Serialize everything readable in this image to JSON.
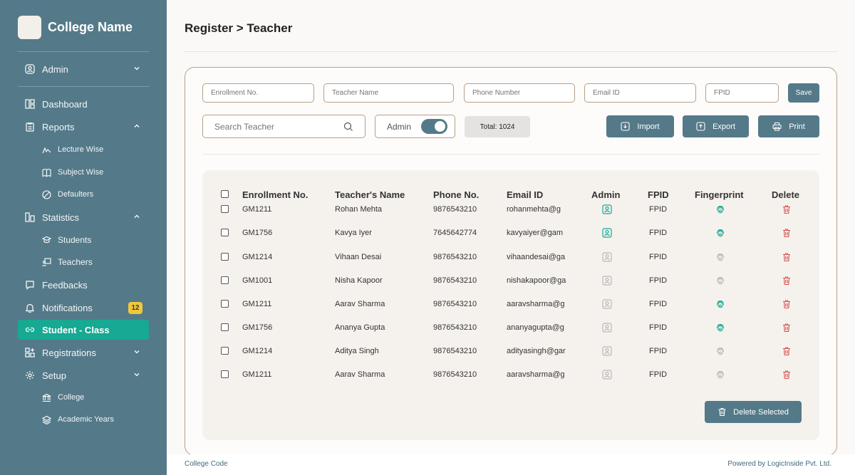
{
  "brand": {
    "name": "College Name"
  },
  "sidebar": {
    "admin_label": "Admin",
    "items": [
      {
        "label": "Dashboard",
        "icon": "dashboard-icon"
      },
      {
        "label": "Reports",
        "icon": "reports-icon"
      },
      {
        "label": "Lecture Wise",
        "icon": "lecture-icon"
      },
      {
        "label": "Subject Wise",
        "icon": "book-icon"
      },
      {
        "label": "Defaulters",
        "icon": "ban-icon"
      },
      {
        "label": "Statistics",
        "icon": "statistics-icon"
      },
      {
        "label": "Students",
        "icon": "student-icon"
      },
      {
        "label": "Teachers",
        "icon": "teacher-icon"
      },
      {
        "label": "Feedbacks",
        "icon": "feedback-icon"
      },
      {
        "label": "Notifications",
        "icon": "bell-icon",
        "badge": "12"
      },
      {
        "label": "Student - Class",
        "icon": "link-icon",
        "active": true
      },
      {
        "label": "Registrations",
        "icon": "registrations-icon"
      },
      {
        "label": "Setup",
        "icon": "gear-icon"
      },
      {
        "label": "College",
        "icon": "college-icon"
      },
      {
        "label": "Academic Years",
        "icon": "layers-icon"
      }
    ]
  },
  "header": {
    "breadcrumb": "Register > Teacher"
  },
  "form": {
    "enrollment_placeholder": "Enrollment No.",
    "teacher_name_placeholder": "Teacher Name",
    "phone_placeholder": "Phone Number",
    "email_placeholder": "Email ID",
    "fpid_placeholder": "FPID",
    "save_label": "Save"
  },
  "toolbar": {
    "search_placeholder": "Search Teacher",
    "admin_toggle_label": "Admin",
    "admin_toggle_on": true,
    "total_label": "Total: 1024",
    "import_label": "Import",
    "export_label": "Export",
    "print_label": "Print"
  },
  "table": {
    "headers": [
      "Enrollment No.",
      "Teacher's Name",
      "Phone No.",
      "Email ID",
      "Admin",
      "FPID",
      "Fingerprint",
      "Delete"
    ],
    "rows": [
      {
        "enrollment": "GM1211",
        "name": "Rohan Mehta",
        "phone": "9876543210",
        "email": "rohanmehta@g",
        "admin": true,
        "fpid": "FPID",
        "fingerprint": true
      },
      {
        "enrollment": "GM1756",
        "name": "Kavya Iyer",
        "phone": "7645642774",
        "email": "kavyaiyer@gam",
        "admin": true,
        "fpid": "FPID",
        "fingerprint": true
      },
      {
        "enrollment": "GM1214",
        "name": "Vihaan Desai",
        "phone": "9876543210",
        "email": "vihaandesai@ga",
        "admin": false,
        "fpid": "FPID",
        "fingerprint": false
      },
      {
        "enrollment": "GM1001",
        "name": "Nisha Kapoor",
        "phone": "9876543210",
        "email": "nishakapoor@ga",
        "admin": false,
        "fpid": "FPID",
        "fingerprint": false
      },
      {
        "enrollment": "GM1211",
        "name": "Aarav Sharma",
        "phone": "9876543210",
        "email": "aaravsharma@g",
        "admin": false,
        "fpid": "FPID",
        "fingerprint": true
      },
      {
        "enrollment": "GM1756",
        "name": "Ananya Gupta",
        "phone": "9876543210",
        "email": "ananyagupta@g",
        "admin": false,
        "fpid": "FPID",
        "fingerprint": true
      },
      {
        "enrollment": "GM1214",
        "name": "Aditya Singh",
        "phone": "9876543210",
        "email": "adityasingh@gar",
        "admin": false,
        "fpid": "FPID",
        "fingerprint": false
      },
      {
        "enrollment": "GM1211",
        "name": "Aarav Sharma",
        "phone": "9876543210",
        "email": "aaravsharma@g",
        "admin": false,
        "fpid": "FPID",
        "fingerprint": false
      }
    ],
    "delete_selected_label": "Delete Selected"
  },
  "footer": {
    "left": "College Code",
    "right": "Powered by LogicInside Pvt. Ltd."
  },
  "colors": {
    "sidebar": "#547a89",
    "active": "#17a992",
    "badge": "#f2c83b",
    "delete": "#d9534f",
    "admin_on": "#17a992"
  }
}
